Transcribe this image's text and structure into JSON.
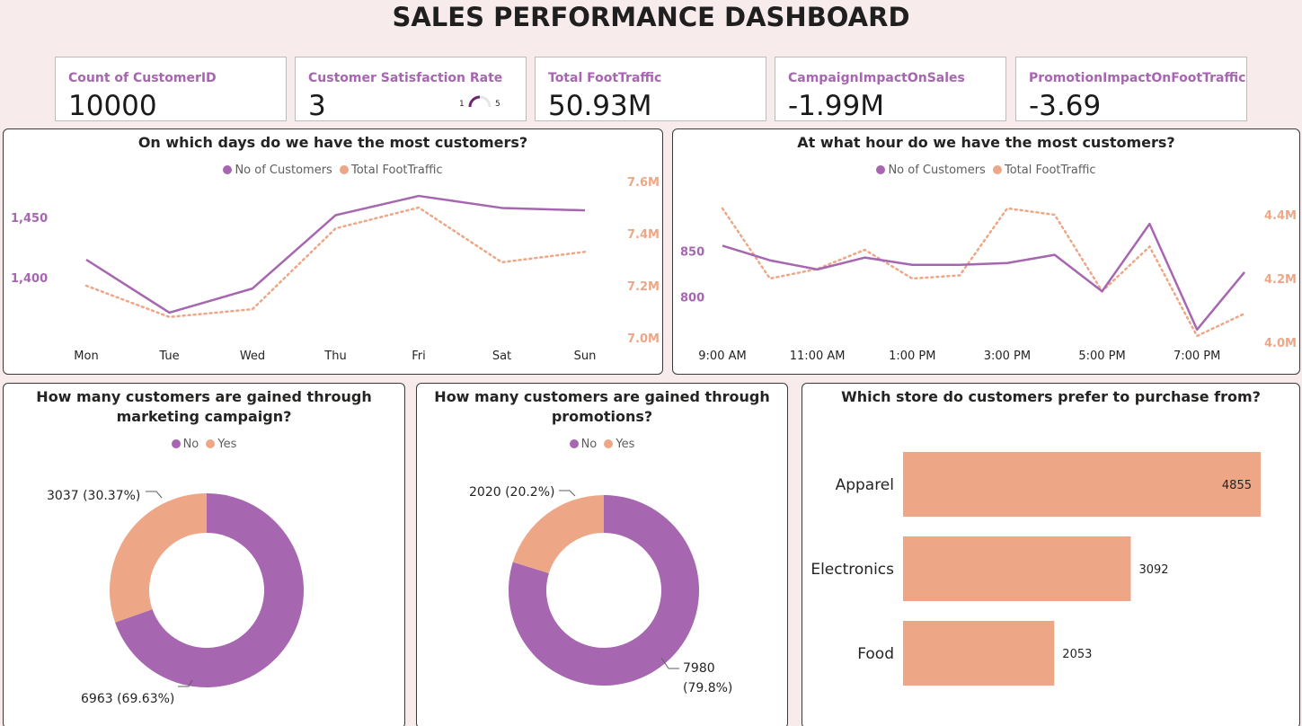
{
  "title": "SALES PERFORMANCE DASHBOARD",
  "colors": {
    "purple": "#a666b0",
    "orange": "#eda787",
    "dark_purple": "#6d2770"
  },
  "kpis": [
    {
      "label": "Count of CustomerID",
      "value": "10000"
    },
    {
      "label": "Customer Satisfaction Rate",
      "value": "3",
      "gauge_min": "1",
      "gauge_max": "5"
    },
    {
      "label": "Total FootTraffic",
      "value": "50.93M"
    },
    {
      "label": "CampaignImpactOnSales",
      "value": "-1.99M"
    },
    {
      "label": "PromotionImpactOnFootTraffic",
      "value": "-3.69"
    }
  ],
  "chart_data": [
    {
      "type": "line",
      "title": "On which days do we have the most customers?",
      "categories": [
        "Mon",
        "Tue",
        "Wed",
        "Thu",
        "Fri",
        "Sat",
        "Sun"
      ],
      "series": [
        {
          "name": "No of Customers",
          "axis": "left",
          "style": "solid",
          "values": [
            1415,
            1371,
            1391,
            1452,
            1468,
            1458,
            1456
          ]
        },
        {
          "name": "Total FootTraffic",
          "axis": "right",
          "style": "dotted",
          "values": [
            7.2,
            7.08,
            7.11,
            7.42,
            7.5,
            7.29,
            7.33
          ]
        }
      ],
      "left_ticks": [
        {
          "label": "1,400",
          "value": 1400
        },
        {
          "label": "1,450",
          "value": 1450
        }
      ],
      "left_range": [
        1350,
        1480
      ],
      "right_ticks": [
        {
          "label": "7.0M",
          "value": 7.0
        },
        {
          "label": "7.2M",
          "value": 7.2
        },
        {
          "label": "7.4M",
          "value": 7.4
        },
        {
          "label": "7.6M",
          "value": 7.6
        }
      ],
      "right_range": [
        7.0,
        7.6
      ],
      "legend_position": "top-center",
      "grid": false
    },
    {
      "type": "line",
      "title": "At what hour do we have the most customers?",
      "x": [
        9,
        10,
        11,
        12,
        13,
        14,
        15,
        16,
        17,
        18,
        19,
        20
      ],
      "x_tick_labels": [
        {
          "label": "9:00 AM",
          "x": 9
        },
        {
          "label": "11:00 AM",
          "x": 11
        },
        {
          "label": "1:00 PM",
          "x": 13
        },
        {
          "label": "3:00 PM",
          "x": 15
        },
        {
          "label": "5:00 PM",
          "x": 17
        },
        {
          "label": "7:00 PM",
          "x": 19
        }
      ],
      "series": [
        {
          "name": "No of Customers",
          "axis": "left",
          "style": "solid",
          "values": [
            856,
            840,
            830,
            843,
            835,
            835,
            837,
            846,
            806,
            880,
            764,
            827
          ]
        },
        {
          "name": "Total FootTraffic",
          "axis": "right",
          "style": "dotted",
          "values": [
            4.42,
            4.2,
            4.23,
            4.29,
            4.2,
            4.21,
            4.42,
            4.4,
            4.16,
            4.3,
            4.02,
            4.09
          ]
        }
      ],
      "left_ticks": [
        {
          "label": "800",
          "value": 800
        },
        {
          "label": "850",
          "value": 850
        }
      ],
      "left_range": [
        750,
        890
      ],
      "right_ticks": [
        {
          "label": "4.0M",
          "value": 4.0
        },
        {
          "label": "4.2M",
          "value": 4.2
        },
        {
          "label": "4.4M",
          "value": 4.4
        }
      ],
      "right_range": [
        4.0,
        4.4
      ],
      "legend_position": "top-center",
      "grid": false
    },
    {
      "type": "pie",
      "donut": true,
      "title": "How many customers are gained through marketing campaign?",
      "title_lines": [
        "How many customers are gained through",
        "marketing campaign?"
      ],
      "slices": [
        {
          "name": "No",
          "value": 6963,
          "label": "6963 (69.63%)"
        },
        {
          "name": "Yes",
          "value": 3037,
          "label": "3037 (30.37%)"
        }
      ]
    },
    {
      "type": "pie",
      "donut": true,
      "title": "How many customers are gained through promotions?",
      "title_lines": [
        "How many customers are gained through",
        "promotions?"
      ],
      "slices": [
        {
          "name": "No",
          "value": 7980,
          "label_lines": [
            "7980",
            "(79.8%)"
          ]
        },
        {
          "name": "Yes",
          "value": 2020,
          "label": "2020 (20.2%)"
        }
      ]
    },
    {
      "type": "bar",
      "orientation": "horizontal",
      "title": "Which store do customers prefer to purchase from?",
      "categories": [
        "Apparel",
        "Electronics",
        "Food"
      ],
      "values": [
        4855,
        3092,
        2053
      ],
      "xlim": [
        0,
        4855
      ]
    }
  ]
}
